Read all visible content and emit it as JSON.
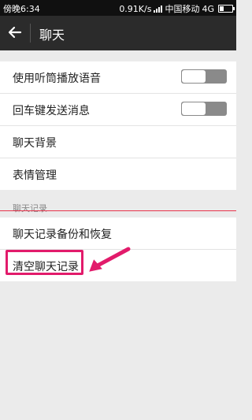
{
  "status_bar": {
    "time": "傍晚6:34",
    "network_speed": "0.91K/s",
    "carrier": "中国移动",
    "network_type": "4G"
  },
  "toolbar": {
    "title": "聊天",
    "back_icon": "arrow-left-icon"
  },
  "settings": [
    {
      "label": "使用听筒播放语音",
      "type": "toggle",
      "value": false
    },
    {
      "label": "回车键发送消息",
      "type": "toggle",
      "value": false
    },
    {
      "label": "聊天背景",
      "type": "link"
    },
    {
      "label": "表情管理",
      "type": "link"
    }
  ],
  "chat_history": {
    "section_title": "聊天记录",
    "items": [
      {
        "label": "聊天记录备份和恢复"
      },
      {
        "label": "清空聊天记录"
      }
    ]
  },
  "annotation": {
    "highlight_color": "#e21b6b",
    "arrow_color": "#e21b6b"
  },
  "colors": {
    "toolbar_bg": "#2b2b2b",
    "page_bg": "#ebebeb",
    "toggle_off": "#8a8a8a"
  }
}
